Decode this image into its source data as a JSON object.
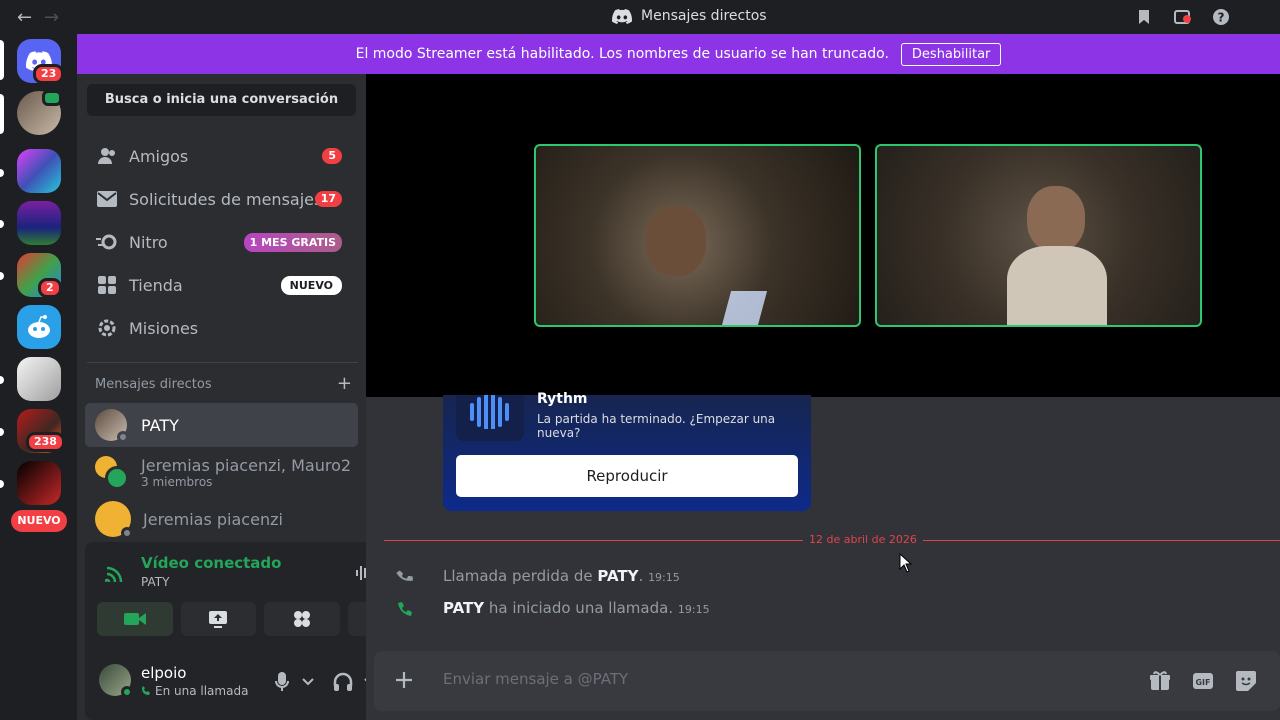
{
  "titlebar": {
    "title": "Mensajes directos",
    "back": "←",
    "forward": "→"
  },
  "rail": {
    "badges": {
      "home": "23",
      "server4": "2",
      "server8": "238"
    },
    "nuevo": "NUEVO"
  },
  "banner": {
    "text": "El modo Streamer está habilitado. Los nombres de usuario se han truncado.",
    "button": "Deshabilitar",
    "color": "#8c34e6"
  },
  "sidebar": {
    "search": "Busca o inicia una conversación",
    "nav": [
      {
        "label": "Amigos",
        "badge": "5",
        "icon": "friends-icon"
      },
      {
        "label": "Solicitudes de mensajes",
        "badge": "17",
        "icon": "mail-icon"
      },
      {
        "label": "Nitro",
        "badge": "1 MES GRATIS",
        "icon": "nitro-icon"
      },
      {
        "label": "Tienda",
        "badge": "NUEVO",
        "icon": "shop-icon"
      },
      {
        "label": "Misiones",
        "icon": "quests-icon"
      }
    ],
    "dm_header": "Mensajes directos",
    "dm_add": "+",
    "dms": [
      {
        "name": "PATY"
      },
      {
        "name": "Jeremias piacenzi, Mauro2",
        "sub": "3 miembros"
      },
      {
        "name": "Jeremias piacenzi"
      }
    ]
  },
  "voice": {
    "title": "Vídeo conectado",
    "channel": "PATY"
  },
  "user": {
    "name": "elpoio",
    "status": "En una llamada"
  },
  "activity": {
    "name": "Rythm",
    "description": "La partida ha terminado. ¿Empezar una nueva?",
    "button": "Reproducir"
  },
  "chat": {
    "date": "12 de abril de 2026",
    "messages": [
      {
        "prefix": "Llamada perdida de ",
        "user": "PATY",
        "suffix": ".",
        "time": "19:15"
      },
      {
        "prefix": "",
        "user": "PATY",
        "suffix": " ha iniciado una llamada.",
        "time": "19:15"
      }
    ],
    "composer_placeholder": "Enviar mensaje a @PATY"
  },
  "colors": {
    "green": "#23a55a",
    "red": "#f23f43",
    "blurple": "#5865f2"
  }
}
